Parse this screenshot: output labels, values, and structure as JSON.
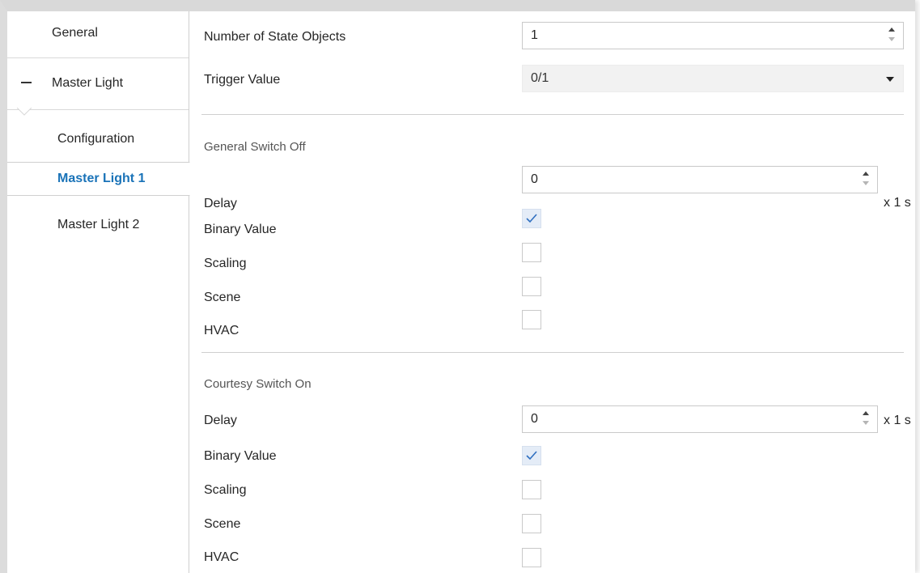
{
  "sidebar": {
    "general_label": "General",
    "group_label": "Master Light",
    "items": [
      {
        "label": "Configuration"
      },
      {
        "label": "Master Light 1"
      },
      {
        "label": "Master Light 2"
      }
    ]
  },
  "main": {
    "num_state_objects": {
      "label": "Number of State Objects",
      "value": "1"
    },
    "trigger_value": {
      "label": "Trigger Value",
      "value": "0/1"
    },
    "general_switch_off": {
      "title": "General Switch Off",
      "delay_label": "Delay",
      "delay_value": "0",
      "delay_unit": "x 1 s",
      "binary_label": "Binary Value",
      "binary_checked": true,
      "scaling_label": "Scaling",
      "scaling_checked": false,
      "scene_label": "Scene",
      "scene_checked": false,
      "hvac_label": "HVAC",
      "hvac_checked": false
    },
    "courtesy_switch_on": {
      "title": "Courtesy Switch On",
      "delay_label": "Delay",
      "delay_value": "0",
      "delay_unit": "x 1 s",
      "binary_label": "Binary Value",
      "binary_checked": true,
      "scaling_label": "Scaling",
      "scaling_checked": false,
      "scene_label": "Scene",
      "scene_checked": false,
      "hvac_label": "HVAC",
      "hvac_checked": false
    }
  },
  "colors": {
    "accent": "#1a73b8",
    "checkbox_checked_bg": "#e4ecf7",
    "checkmark": "#2f6fc0"
  }
}
